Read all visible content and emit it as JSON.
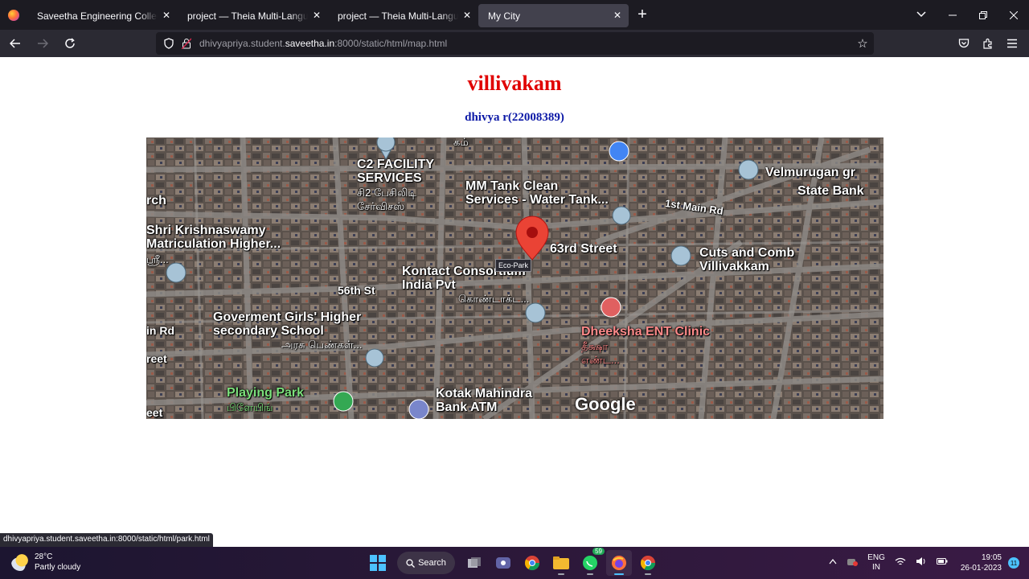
{
  "browser": {
    "tabs": [
      {
        "title": "Saveetha Engineering College",
        "active": false
      },
      {
        "title": "project — Theia Multi-Language Ex",
        "active": false
      },
      {
        "title": "project — Theia Multi-Language Ex",
        "active": false
      },
      {
        "title": "My City",
        "active": true
      }
    ],
    "url": {
      "prefix": "dhivyapriya.student.",
      "host": "saveetha.in",
      "suffix": ":8000/static/html/map.html"
    },
    "status_url": "dhivyapriya.student.saveetha.in:8000/static/html/park.html"
  },
  "page": {
    "heading": "villivakam",
    "subheading": "dhivya r(22008389)",
    "heading_color": "#e00000",
    "subheading_color": "#0b18a6",
    "map": {
      "tooltip": "Eco-Park",
      "attribution": "Google",
      "labels": {
        "c2": "C2 FACILITY\nSERVICES",
        "c2_ta": "சி2 பேசிலிடி\nசேர்விசஸ்",
        "mm_tank": "MM Tank Clean\nServices - Water Tank...",
        "main_rd": "1st Main Rd",
        "velmurugan": "Velmurugan gr",
        "state_bank": "State Bank",
        "rch": "rch",
        "shri": "Shri Krishnaswamy\nMatriculation Higher...",
        "shri_ta": "ஸ்ரீ...",
        "street63": "63rd Street",
        "cuts": "Cuts and Comb\nVillivakkam",
        "kontact": "Kontact Consortium\nIndia Pvt",
        "kontact_ta": "கொண்டாக்ட...",
        "st56": "56th St",
        "govt": "Goverment Girls' Higher\nsecondary School",
        "govt_ta": "அரசு பெண்கள்...",
        "in_rd": "in Rd",
        "reet": "reet",
        "dheeksha": "Dheeksha ENT Clinic",
        "dheeksha_ta": "தீக்ஷா\nஎண்ட...",
        "playing": "Playing Park",
        "playing_ta": "பிளேயிங்",
        "kotak": "Kotak Mahindra\nBank ATM",
        "eet": "eet",
        "tam": "கம்"
      }
    }
  },
  "taskbar": {
    "temperature": "28°C",
    "weather": "Partly cloudy",
    "search_label": "Search",
    "whatsapp_badge": "59",
    "lang_line1": "ENG",
    "lang_line2": "IN",
    "time": "19:05",
    "date": "26-01-2023",
    "notifications": "11"
  }
}
